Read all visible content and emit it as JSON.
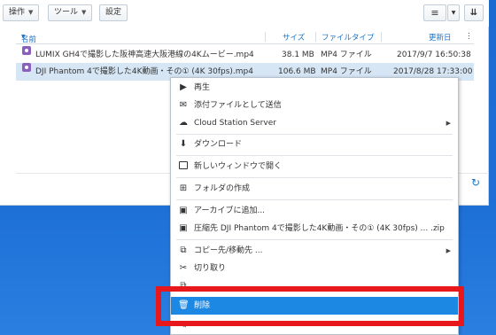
{
  "toolbar": {
    "action_label": "操作",
    "tools_label": "ツール",
    "settings_label": "設定"
  },
  "list": {
    "columns": {
      "name": "名前",
      "size": "サイズ",
      "type": "ファイルタイプ",
      "modified": "更新日"
    },
    "rows": [
      {
        "name": "LUMIX GH4で撮影した阪神高速大阪港線の4Kムービー.mp4",
        "size": "38.1 MB",
        "type": "MP4 ファイル",
        "modified": "2017/9/7 16:50:38"
      },
      {
        "name": "DJI Phantom 4で撮影した4K動画・その① (4K 30fps).mp4",
        "size": "106.6 MB",
        "type": "MP4 ファイル",
        "modified": "2017/8/28 17:33:00"
      }
    ]
  },
  "menu": {
    "play": "再生",
    "send_attachment": "添付ファイルとして送信",
    "cloud_station": "Cloud Station Server",
    "download": "ダウンロード",
    "open_new_window": "新しいウィンドウで開く",
    "create_folder": "フォルダの作成",
    "add_archive": "アーカイブに追加...",
    "compress_to": "圧縮先 DJI Phantom 4で撮影した4K動画・その① (4K 30fps) ... .zip",
    "copy_move": "コピー先/移動先 ...",
    "cut": "切り取り",
    "delete": "削除"
  },
  "colors": {
    "desktop": "#1d6fd6",
    "highlight": "#1d87e4",
    "annotation": "#e8171c",
    "link": "#1a73c9"
  }
}
